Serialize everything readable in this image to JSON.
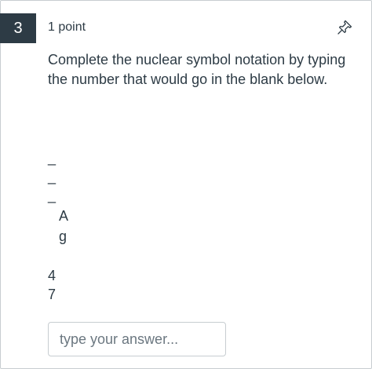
{
  "question": {
    "number": "3",
    "points": "1 point",
    "text": "Complete the nuclear symbol notation by typing the number that would go in the blank below.",
    "notation_glyphs": [
      "_",
      "_",
      "_",
      "A",
      "g",
      "4",
      "7"
    ]
  },
  "icons": {
    "pin": "pin-icon"
  },
  "answer": {
    "placeholder": "type your answer...",
    "value": ""
  }
}
